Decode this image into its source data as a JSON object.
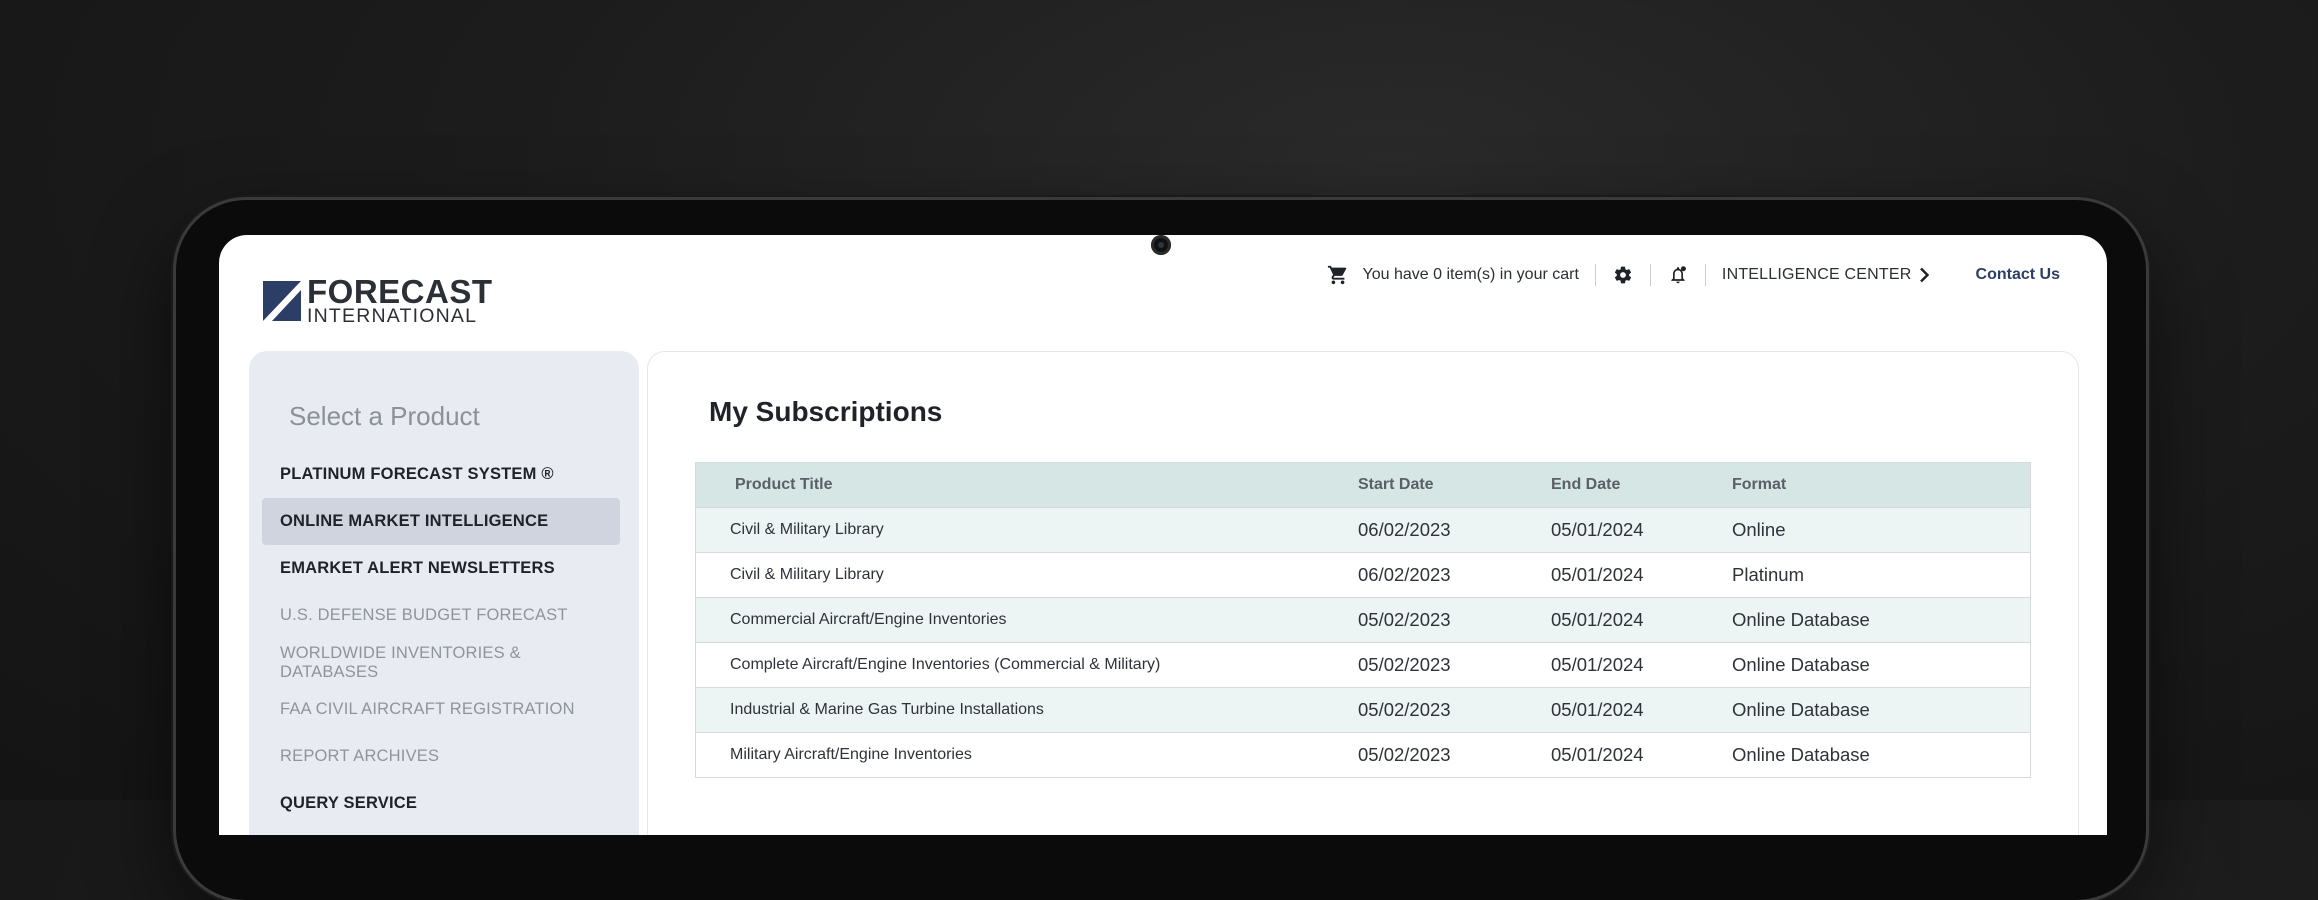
{
  "logo": {
    "top": "FORECAST",
    "bottom": "INTERNATIONAL"
  },
  "header": {
    "cart_text": "You have 0 item(s) in your cart",
    "intelligence_center": "INTELLIGENCE CENTER",
    "contact": "Contact Us"
  },
  "sidebar": {
    "title": "Select a Product",
    "items": [
      {
        "label": "PLATINUM FORECAST SYSTEM ®"
      },
      {
        "label": "ONLINE MARKET INTELLIGENCE"
      },
      {
        "label": "EMARKET ALERT NEWSLETTERS"
      },
      {
        "label": "U.S. DEFENSE BUDGET FORECAST"
      },
      {
        "label": "WORLDWIDE INVENTORIES & DATABASES"
      },
      {
        "label": "FAA CIVIL AIRCRAFT REGISTRATION"
      },
      {
        "label": "REPORT ARCHIVES"
      },
      {
        "label": "QUERY SERVICE"
      }
    ]
  },
  "main": {
    "title": "My Subscriptions",
    "columns": [
      "Product Title",
      "Start Date",
      "End Date",
      "Format"
    ],
    "rows": [
      [
        "Civil & Military Library",
        "06/02/2023",
        "05/01/2024",
        "Online"
      ],
      [
        "Civil & Military Library",
        "06/02/2023",
        "05/01/2024",
        "Platinum"
      ],
      [
        "Commercial Aircraft/Engine Inventories",
        "05/02/2023",
        "05/01/2024",
        "Online Database"
      ],
      [
        "Complete Aircraft/Engine Inventories (Commercial & Military)",
        "05/02/2023",
        "05/01/2024",
        "Online Database"
      ],
      [
        "Industrial & Marine Gas Turbine Installations",
        "05/02/2023",
        "05/01/2024",
        "Online Database"
      ],
      [
        "Military Aircraft/Engine Inventories",
        "05/02/2023",
        "05/01/2024",
        "Online Database"
      ]
    ]
  }
}
